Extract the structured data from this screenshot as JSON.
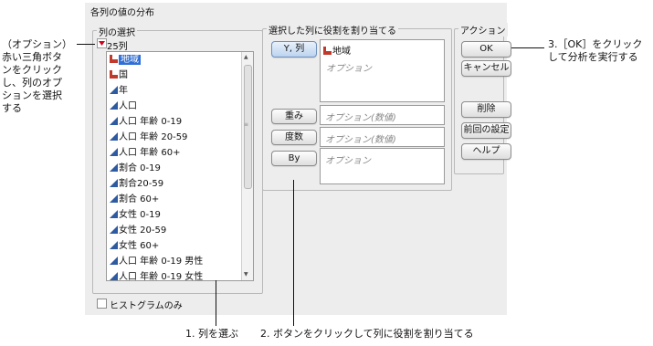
{
  "dialog": {
    "title": "各列の値の分布",
    "column_select": {
      "label": "列の選択",
      "count_label": "25列",
      "items": [
        {
          "label": "地域",
          "type": "nominal",
          "selected": true
        },
        {
          "label": "国",
          "type": "nominal",
          "selected": false
        },
        {
          "label": "年",
          "type": "continuous",
          "selected": false
        },
        {
          "label": "人口",
          "type": "continuous",
          "selected": false
        },
        {
          "label": "人口 年齢 0-19",
          "type": "continuous",
          "selected": false
        },
        {
          "label": "人口 年齢 20-59",
          "type": "continuous",
          "selected": false
        },
        {
          "label": "人口 年齢 60+",
          "type": "continuous",
          "selected": false
        },
        {
          "label": "割合 0-19",
          "type": "continuous",
          "selected": false
        },
        {
          "label": "割合20-59",
          "type": "continuous",
          "selected": false
        },
        {
          "label": "割合 60+",
          "type": "continuous",
          "selected": false
        },
        {
          "label": "女性 0-19",
          "type": "continuous",
          "selected": false
        },
        {
          "label": "女性 20-59",
          "type": "continuous",
          "selected": false
        },
        {
          "label": "女性 60+",
          "type": "continuous",
          "selected": false
        },
        {
          "label": "人口 年齢 0-19 男性",
          "type": "continuous",
          "selected": false
        },
        {
          "label": "人口 年齢 0-19 女性",
          "type": "continuous",
          "selected": false
        }
      ],
      "histogram_only_label": "ヒストグラムのみ",
      "histogram_only_checked": false
    },
    "roles": {
      "label": "選択した列に役割を割り当てる",
      "y_button": "Y, 列",
      "y_assigned": "地域",
      "y_placeholder": "オプション",
      "weight_button": "重み",
      "weight_placeholder": "オプション(数値)",
      "freq_button": "度数",
      "freq_placeholder": "オプション(数値)",
      "by_button": "By",
      "by_placeholder": "オプション"
    },
    "actions": {
      "label": "アクション",
      "ok": "OK",
      "cancel": "キャンセル",
      "remove": "削除",
      "recall": "前回の設定",
      "help": "ヘルプ"
    }
  },
  "annotations": {
    "left_callout": [
      "（オプション）",
      "赤い三角ボタ",
      "ンをクリック",
      "し、列のオプ",
      "ションを選択",
      "する"
    ],
    "ok_callout": [
      "3.［OK］をクリック",
      "して分析を実行する"
    ],
    "step1": "1. 列を選ぶ",
    "step2": "2. ボタンをクリックして列に役割を割り当てる"
  },
  "colors": {
    "selection": "#2f6fd6",
    "nominal_icon": "#c0392b",
    "continuous_icon": "#2d5aa0",
    "red_triangle": "#d0021b"
  }
}
